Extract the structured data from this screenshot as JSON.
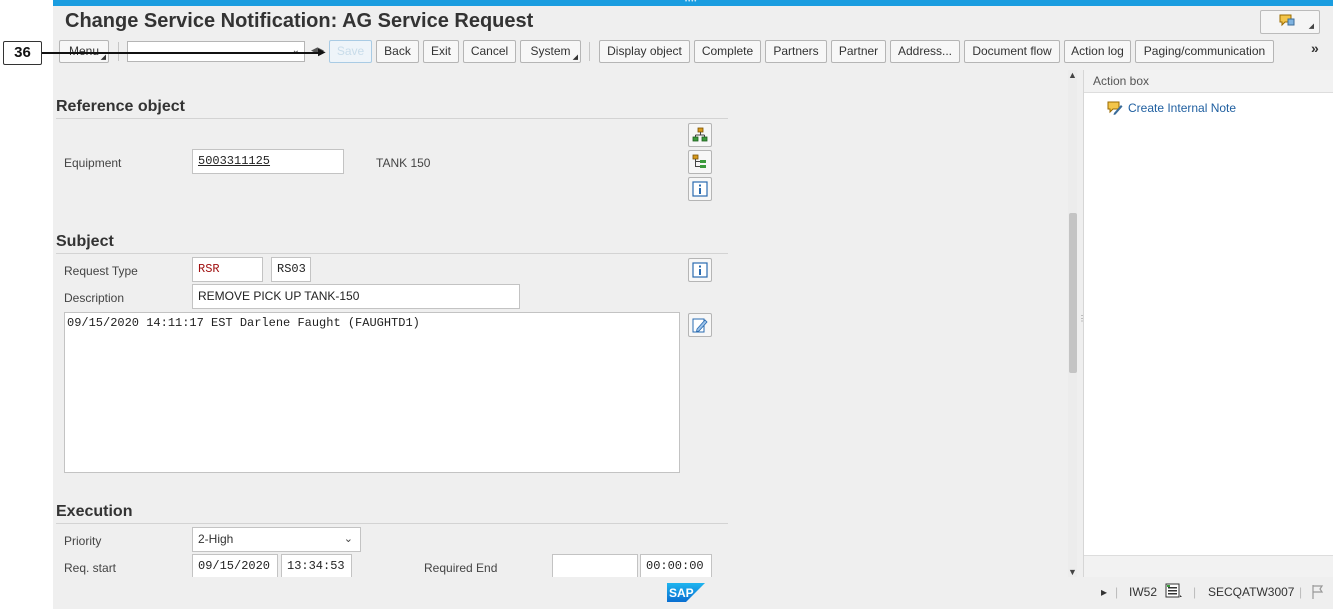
{
  "window": {
    "title": "Change Service Notification: AG Service Request"
  },
  "annotation": {
    "callout_number": "36"
  },
  "toolbar": {
    "menu": "Menu",
    "command_field": "",
    "save": "Save",
    "back": "Back",
    "exit": "Exit",
    "cancel": "Cancel",
    "system": "System",
    "display_object": "Display object",
    "complete": "Complete",
    "partners": "Partners",
    "partner": "Partner",
    "address": "Address...",
    "document_flow": "Document flow",
    "action_log": "Action log",
    "paging": "Paging/communication",
    "more": "»"
  },
  "reference_object": {
    "title": "Reference object",
    "equipment_label": "Equipment",
    "equipment_value": "5003311125",
    "equipment_description": "TANK 150"
  },
  "subject": {
    "title": "Subject",
    "request_type_label": "Request Type",
    "request_type_value": "RSR",
    "request_type_code": "RS03",
    "description_label": "Description",
    "description_value": "REMOVE PICK UP TANK-150",
    "long_text": "09/15/2020 14:11:17 EST Darlene Faught (FAUGHTD1)"
  },
  "execution": {
    "title": "Execution",
    "priority_label": "Priority",
    "priority_value": "2-High",
    "req_start_label": "Req. start",
    "req_start_date": "09/15/2020",
    "req_start_time": "13:34:53",
    "required_end_label": "Required End",
    "required_end_date": "",
    "required_end_time": "00:00:00"
  },
  "action_box": {
    "header": "Action box",
    "items": [
      {
        "label": "Create Internal Note",
        "icon": "note-pencil-icon"
      }
    ]
  },
  "status_bar": {
    "transaction": "IW52",
    "system": "SECQATW3007",
    "logo": "SAP"
  },
  "colors": {
    "accent": "#1a9de0",
    "link": "#1f5fa0",
    "required_value": "#a01010"
  }
}
